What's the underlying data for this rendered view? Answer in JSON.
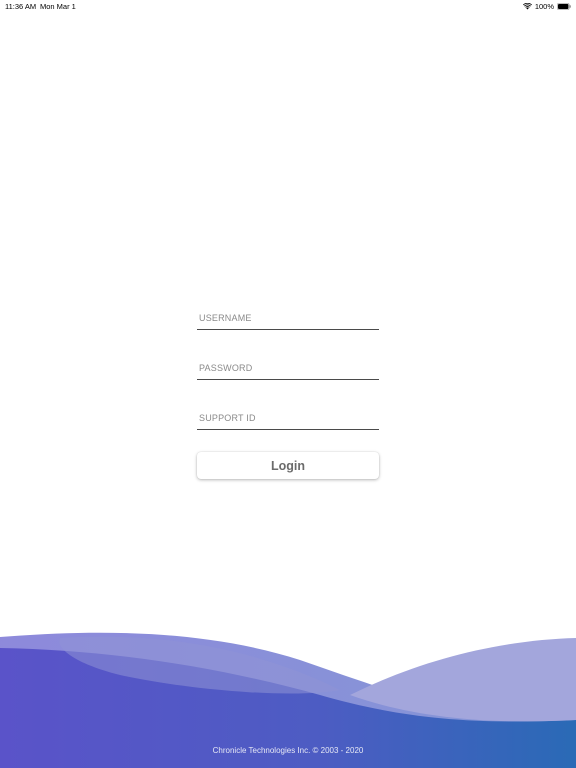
{
  "status_bar": {
    "time": "11:36 AM",
    "date": "Mon Mar 1",
    "battery": "100%"
  },
  "login_form": {
    "username_placeholder": "USERNAME",
    "password_placeholder": "PASSWORD",
    "support_id_placeholder": "SUPPORT ID",
    "login_label": "Login"
  },
  "footer": {
    "copyright": "Chronicle Technologies Inc. © 2003 - 2020"
  },
  "colors": {
    "wave_primary": "#5a56c8",
    "wave_light": "#a3a6dc",
    "wave_blue": "#2f6bb8",
    "text_gray": "#8a8a8a"
  }
}
